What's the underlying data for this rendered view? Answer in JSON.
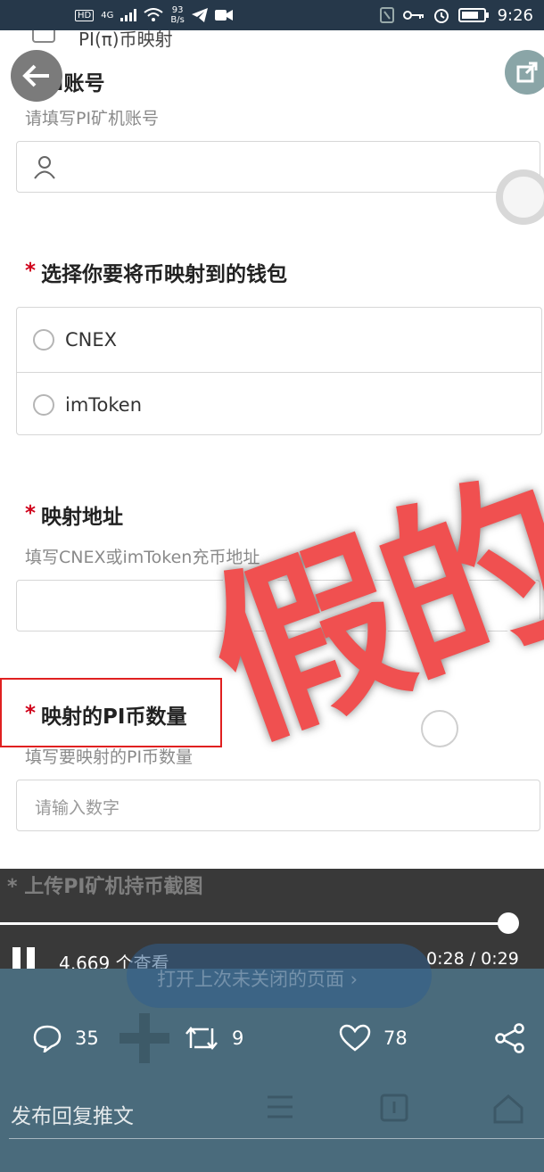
{
  "status_bar": {
    "hd_label": "HD",
    "network_label": "4G",
    "net_speed_value": "93",
    "net_speed_unit": "B/s",
    "time": "9:26"
  },
  "form": {
    "cutoff_row_text": "PI(π)币映射",
    "account": {
      "label": "PI账号",
      "hint": "请填写PI矿机账号"
    },
    "wallet": {
      "label": "选择你要将币映射到的钱包",
      "options": [
        "CNEX",
        "imToken"
      ]
    },
    "address": {
      "label": "映射地址",
      "hint": "填写CNEX或imToken充币地址"
    },
    "amount": {
      "label": "映射的PI币数量",
      "hint": "填写要映射的PI币数量",
      "placeholder": "请输入数字"
    },
    "upload": {
      "label": "上传PI矿机持币截图"
    },
    "required_marker": "*"
  },
  "watermark": {
    "text": "假的",
    "color": "#f05050"
  },
  "video": {
    "views": "4,669 个查看",
    "timecode": "0:28 / 0:29",
    "progress": 0.98,
    "reopen_text": "打开上次未关闭的页面"
  },
  "actions": {
    "comments": "35",
    "retweets": "9",
    "likes": "78"
  },
  "reply": {
    "placeholder": "发布回复推文"
  },
  "colors": {
    "status_bar": "#26384a",
    "bottom_zone": "#4a6b7c",
    "required_star": "#d0021b",
    "highlight_frame": "#e02020"
  }
}
